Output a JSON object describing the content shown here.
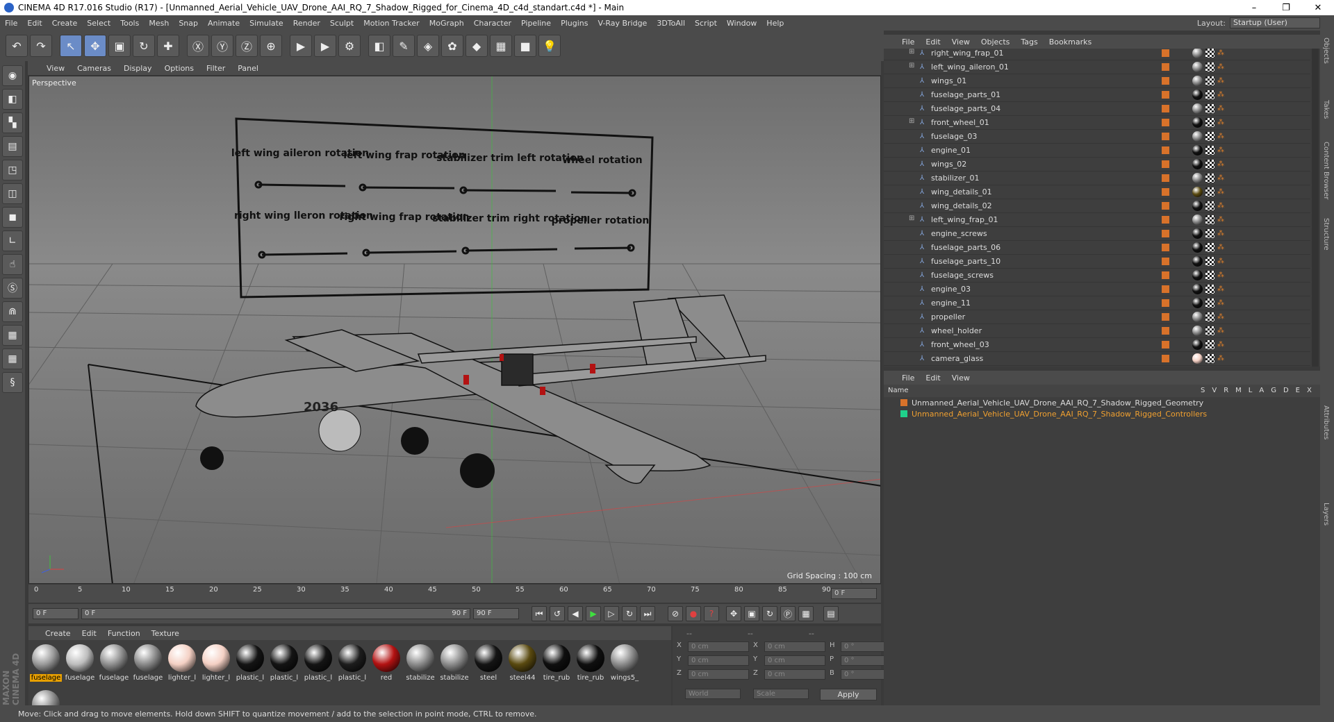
{
  "window": {
    "title": "CINEMA 4D R17.016 Studio (R17) - [Unmanned_Aerial_Vehicle_UAV_Drone_AAI_RQ_7_Shadow_Rigged_for_Cinema_4D_c4d_standart.c4d *] - Main",
    "min": "–",
    "max": "❐",
    "close": "✕"
  },
  "menu": [
    "File",
    "Edit",
    "Create",
    "Select",
    "Tools",
    "Mesh",
    "Snap",
    "Animate",
    "Simulate",
    "Render",
    "Sculpt",
    "Motion Tracker",
    "MoGraph",
    "Character",
    "Pipeline",
    "Plugins",
    "V-Ray Bridge",
    "3DToAll",
    "Script",
    "Window",
    "Help"
  ],
  "layout": {
    "label": "Layout:",
    "value": "Startup (User)"
  },
  "viewport_menu": [
    "View",
    "Cameras",
    "Display",
    "Options",
    "Filter",
    "Panel"
  ],
  "viewport": {
    "label": "Perspective",
    "grid_spacing": "Grid Spacing : 100 cm"
  },
  "board": {
    "labels": [
      "left wing aileron rotation",
      "left wing frap rotation",
      "stabilizer trim left rotation",
      "wheel rotation",
      "right wing lleron rotation",
      "right wing frap rotation",
      "stabilizer trim right rotation",
      "propeller rotation"
    ],
    "fuselage_number": "2036"
  },
  "timeline": {
    "ticks": [
      "0",
      "5",
      "10",
      "15",
      "20",
      "25",
      "30",
      "35",
      "40",
      "45",
      "50",
      "55",
      "60",
      "65",
      "70",
      "75",
      "80",
      "85",
      "90"
    ],
    "current": "0 F"
  },
  "transport": {
    "start": "0 F",
    "range_start": "0 F",
    "range_end": "90 F",
    "end": "90 F"
  },
  "material_menu": [
    "Create",
    "Edit",
    "Function",
    "Texture"
  ],
  "materials": [
    {
      "name": "fuselage",
      "color": "#9a9a9a",
      "sel": true
    },
    {
      "name": "fuselage",
      "color": "#bdbdbd"
    },
    {
      "name": "fuselage",
      "color": "#8f8f8f"
    },
    {
      "name": "fuselage",
      "color": "#8a8a8a"
    },
    {
      "name": "lighter_l",
      "color": "#f4d0c4"
    },
    {
      "name": "lighter_l",
      "color": "#f4d0c4"
    },
    {
      "name": "plastic_l",
      "color": "#141414"
    },
    {
      "name": "plastic_l",
      "color": "#141414"
    },
    {
      "name": "plastic_l",
      "color": "#141414"
    },
    {
      "name": "plastic_l",
      "color": "#1d1d1d"
    },
    {
      "name": "red",
      "color": "#b31212"
    },
    {
      "name": "stabilize",
      "color": "#8c8c8c"
    },
    {
      "name": "stabilize",
      "color": "#8c8c8c"
    },
    {
      "name": "steel",
      "color": "#141414"
    },
    {
      "name": "steel44",
      "color": "#5a4a10"
    },
    {
      "name": "tire_rub",
      "color": "#0f0f0f"
    },
    {
      "name": "tire_rub",
      "color": "#0f0f0f"
    },
    {
      "name": "wings5_",
      "color": "#8c8c8c"
    },
    {
      "name": "",
      "color": "#8c8c8c"
    }
  ],
  "coords": {
    "header": [
      "--",
      "--",
      "--"
    ],
    "rows": [
      {
        "a": "X",
        "v1": "0 cm",
        "b": "X",
        "v2": "0 cm",
        "c": "H",
        "v3": "0 °"
      },
      {
        "a": "Y",
        "v1": "0 cm",
        "b": "Y",
        "v2": "0 cm",
        "c": "P",
        "v3": "0 °"
      },
      {
        "a": "Z",
        "v1": "0 cm",
        "b": "Z",
        "v2": "0 cm",
        "c": "B",
        "v3": "0 °"
      }
    ],
    "world": "World",
    "scale": "Scale",
    "apply": "Apply"
  },
  "objects_menu": [
    "File",
    "Edit",
    "View",
    "Objects",
    "Tags",
    "Bookmarks"
  ],
  "objects": [
    {
      "name": "right_wing_frap_01",
      "exp": "⊞",
      "mat": "#888"
    },
    {
      "name": "left_wing_aileron_01",
      "exp": "⊞",
      "mat": "#888"
    },
    {
      "name": "wings_01",
      "exp": "",
      "mat": "#888"
    },
    {
      "name": "fuselage_parts_01",
      "exp": "",
      "mat": "#111"
    },
    {
      "name": "fuselage_parts_04",
      "exp": "",
      "mat": "#888"
    },
    {
      "name": "front_wheel_01",
      "exp": "⊞",
      "mat": "#111"
    },
    {
      "name": "fuselage_03",
      "exp": "",
      "mat": "#888"
    },
    {
      "name": "engine_01",
      "exp": "",
      "mat": "#111"
    },
    {
      "name": "wings_02",
      "exp": "",
      "mat": "#111"
    },
    {
      "name": "stabilizer_01",
      "exp": "",
      "mat": "#888"
    },
    {
      "name": "wing_details_01",
      "exp": "",
      "mat": "#5a4a10"
    },
    {
      "name": "wing_details_02",
      "exp": "",
      "mat": "#111"
    },
    {
      "name": "left_wing_frap_01",
      "exp": "⊞",
      "mat": "#888"
    },
    {
      "name": "engine_screws",
      "exp": "",
      "mat": "#111"
    },
    {
      "name": "fuselage_parts_06",
      "exp": "",
      "mat": "#111"
    },
    {
      "name": "fuselage_parts_10",
      "exp": "",
      "mat": "#111"
    },
    {
      "name": "fuselage_screws",
      "exp": "",
      "mat": "#111"
    },
    {
      "name": "engine_03",
      "exp": "",
      "mat": "#111"
    },
    {
      "name": "engine_11",
      "exp": "",
      "mat": "#111"
    },
    {
      "name": "propeller",
      "exp": "",
      "mat": "#888"
    },
    {
      "name": "wheel_holder",
      "exp": "",
      "mat": "#888"
    },
    {
      "name": "front_wheel_03",
      "exp": "",
      "mat": "#111"
    },
    {
      "name": "camera_glass",
      "exp": "",
      "mat": "#f4d0c4"
    }
  ],
  "layers_menu": [
    "File",
    "Edit",
    "View"
  ],
  "layers_header": {
    "name": "Name",
    "cols": [
      "S",
      "V",
      "R",
      "M",
      "L",
      "A",
      "G",
      "D",
      "E",
      "X"
    ]
  },
  "layers": [
    {
      "name": "Unmanned_Aerial_Vehicle_UAV_Drone_AAI_RQ_7_Shadow_Rigged_Geometry",
      "color": "#d8722a",
      "text": "#dddddd"
    },
    {
      "name": "Unmanned_Aerial_Vehicle_UAV_Drone_AAI_RQ_7_Shadow_Rigged_Controllers",
      "color": "#1fd08a",
      "text": "#f0a030"
    }
  ],
  "right_tabs": [
    "Objects",
    "Takes",
    "Content Browser",
    "Structure",
    "Attributes",
    "Layers"
  ],
  "status": "Move: Click and drag to move elements. Hold down SHIFT to quantize movement / add to the selection in point mode, CTRL to remove.",
  "brand": "MAXON CINEMA 4D"
}
